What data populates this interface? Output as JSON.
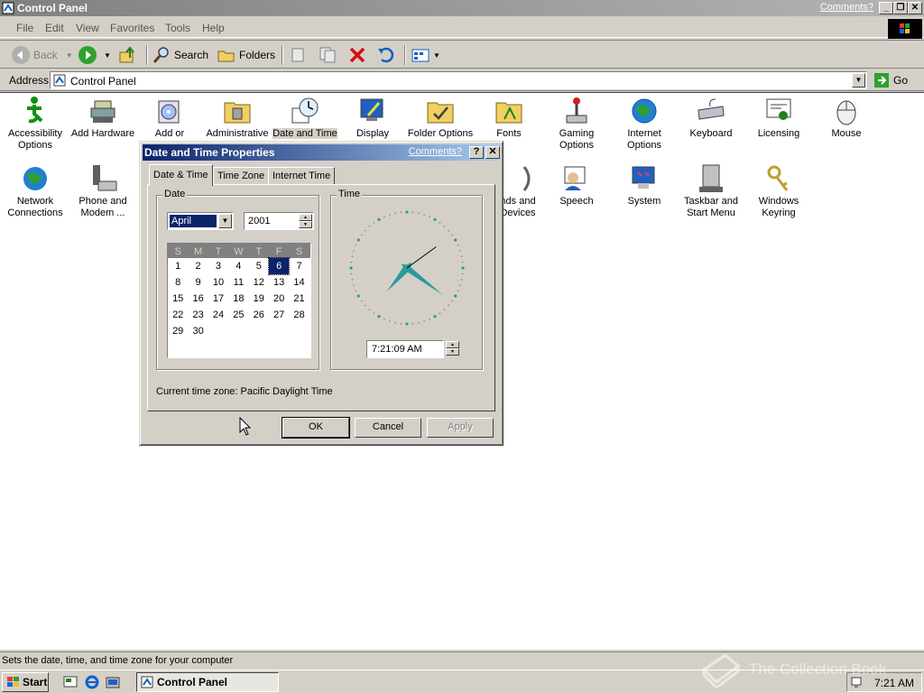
{
  "window": {
    "title": "Control Panel",
    "comments_link": "Comments?",
    "menu": [
      "File",
      "Edit",
      "View",
      "Favorites",
      "Tools",
      "Help"
    ],
    "toolbar": {
      "back": "Back",
      "search": "Search",
      "folders": "Folders"
    },
    "address": {
      "label": "Address",
      "value": "Control Panel",
      "go": "Go"
    },
    "status_text": "Sets the date, time, and time zone for your computer"
  },
  "control_panel_items": [
    {
      "label": "Accessibility Options",
      "icon": "accessibility-icon"
    },
    {
      "label": "Add Hardware",
      "icon": "add-hardware-icon"
    },
    {
      "label": "Add or",
      "icon": "add-remove-programs-icon"
    },
    {
      "label": "Administrative",
      "icon": "administrative-tools-icon"
    },
    {
      "label": "Date and Time",
      "icon": "date-time-icon",
      "selected": true
    },
    {
      "label": "Display",
      "icon": "display-icon"
    },
    {
      "label": "Folder Options",
      "icon": "folder-options-icon"
    },
    {
      "label": "Fonts",
      "icon": "fonts-icon"
    },
    {
      "label": "Gaming Options",
      "icon": "gaming-options-icon"
    },
    {
      "label": "Internet Options",
      "icon": "internet-options-icon"
    },
    {
      "label": "Keyboard",
      "icon": "keyboard-icon"
    },
    {
      "label": "Licensing",
      "icon": "licensing-icon"
    },
    {
      "label": "Mouse",
      "icon": "mouse-icon"
    },
    {
      "label": "Network Connections",
      "icon": "network-connections-icon"
    },
    {
      "label": "Phone and Modem ...",
      "icon": "phone-modem-icon"
    },
    {
      "label": "nds and Devices",
      "icon": "sounds-devices-icon"
    },
    {
      "label": "Speech",
      "icon": "speech-icon"
    },
    {
      "label": "System",
      "icon": "system-icon"
    },
    {
      "label": "Taskbar and Start Menu",
      "icon": "taskbar-icon"
    },
    {
      "label": "Windows Keyring",
      "icon": "keyring-icon"
    }
  ],
  "dialog": {
    "title": "Date and Time Properties",
    "comments_link": "Comments?",
    "help_btn": "?",
    "close_btn": "✕",
    "tabs": [
      "Date & Time",
      "Time Zone",
      "Internet Time"
    ],
    "date_group": "Date",
    "time_group": "Time",
    "month": "April",
    "year": "2001",
    "weekdays": [
      "S",
      "M",
      "T",
      "W",
      "T",
      "F",
      "S"
    ],
    "weeks": [
      [
        "1",
        "2",
        "3",
        "4",
        "5",
        "6",
        "7"
      ],
      [
        "8",
        "9",
        "10",
        "11",
        "12",
        "13",
        "14"
      ],
      [
        "15",
        "16",
        "17",
        "18",
        "19",
        "20",
        "21"
      ],
      [
        "22",
        "23",
        "24",
        "25",
        "26",
        "27",
        "28"
      ],
      [
        "29",
        "30",
        "",
        "",
        "",
        "",
        ""
      ]
    ],
    "selected_day": "6",
    "time": "7:21:09 AM",
    "clock": {
      "hour": 7,
      "minute": 21,
      "second": 9
    },
    "timezone_label": "Current time zone:",
    "timezone_value": "Pacific Daylight Time",
    "buttons": {
      "ok": "OK",
      "cancel": "Cancel",
      "apply": "Apply"
    }
  },
  "taskbar": {
    "start": "Start",
    "task": "Control Panel",
    "clock": "7:21 AM"
  },
  "watermark": "The Collection Book",
  "colors": {
    "titlebar_active": "#0a246a",
    "titlebar_inactive": "#808080",
    "face": "#d4d0c8",
    "clock_hands": "#2a9a9a"
  }
}
